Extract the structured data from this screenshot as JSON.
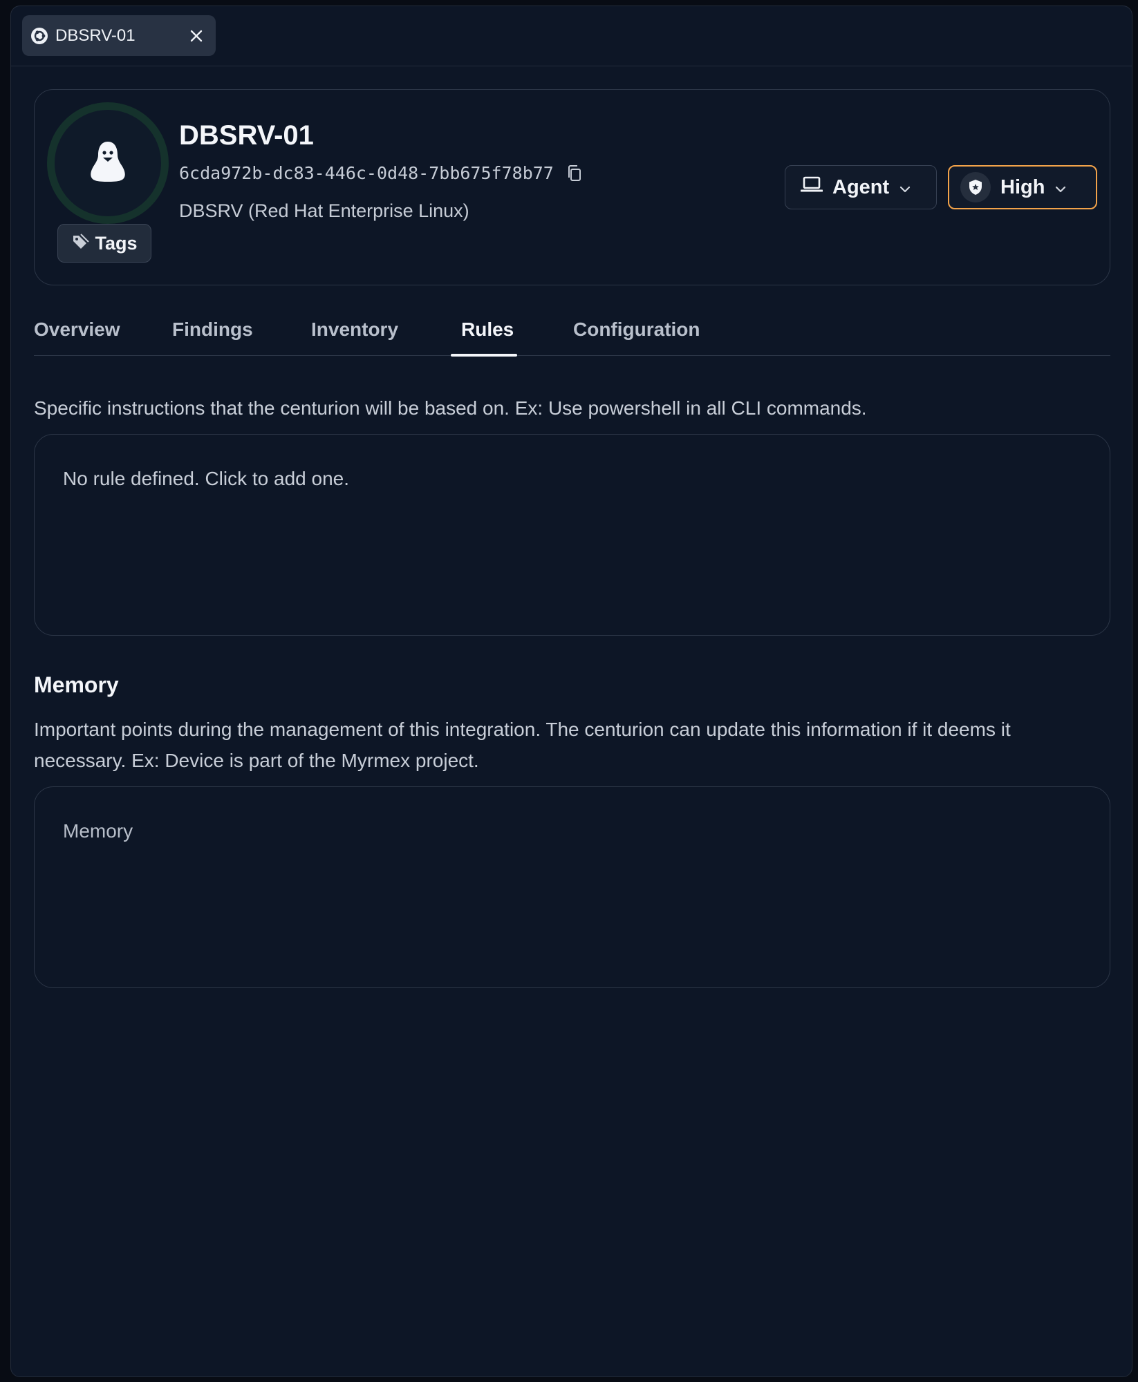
{
  "window_tab": {
    "label": "DBSRV-01"
  },
  "host": {
    "name": "DBSRV-01",
    "uuid": "6cda972b-dc83-446c-0d48-7bb675f78b77",
    "os": "DBSRV (Red Hat Enterprise Linux)",
    "tags_label": "Tags"
  },
  "dropdowns": {
    "agent_label": "Agent",
    "priority_label": "High",
    "priority_color": "#f3a34a"
  },
  "tabs": [
    {
      "label": "Overview"
    },
    {
      "label": "Findings"
    },
    {
      "label": "Inventory"
    },
    {
      "label": "Rules"
    },
    {
      "label": "Configuration"
    }
  ],
  "active_tab": "Rules",
  "rules": {
    "description": "Specific instructions that the centurion will be based on. Ex: Use powershell in all CLI commands.",
    "placeholder": "No rule defined. Click to add one."
  },
  "memory": {
    "title": "Memory",
    "description": "Important points during the management of this integration. The centurion can update this information if it deems it necessary. Ex: Device is part of the Myrmex project.",
    "placeholder": "Memory"
  }
}
